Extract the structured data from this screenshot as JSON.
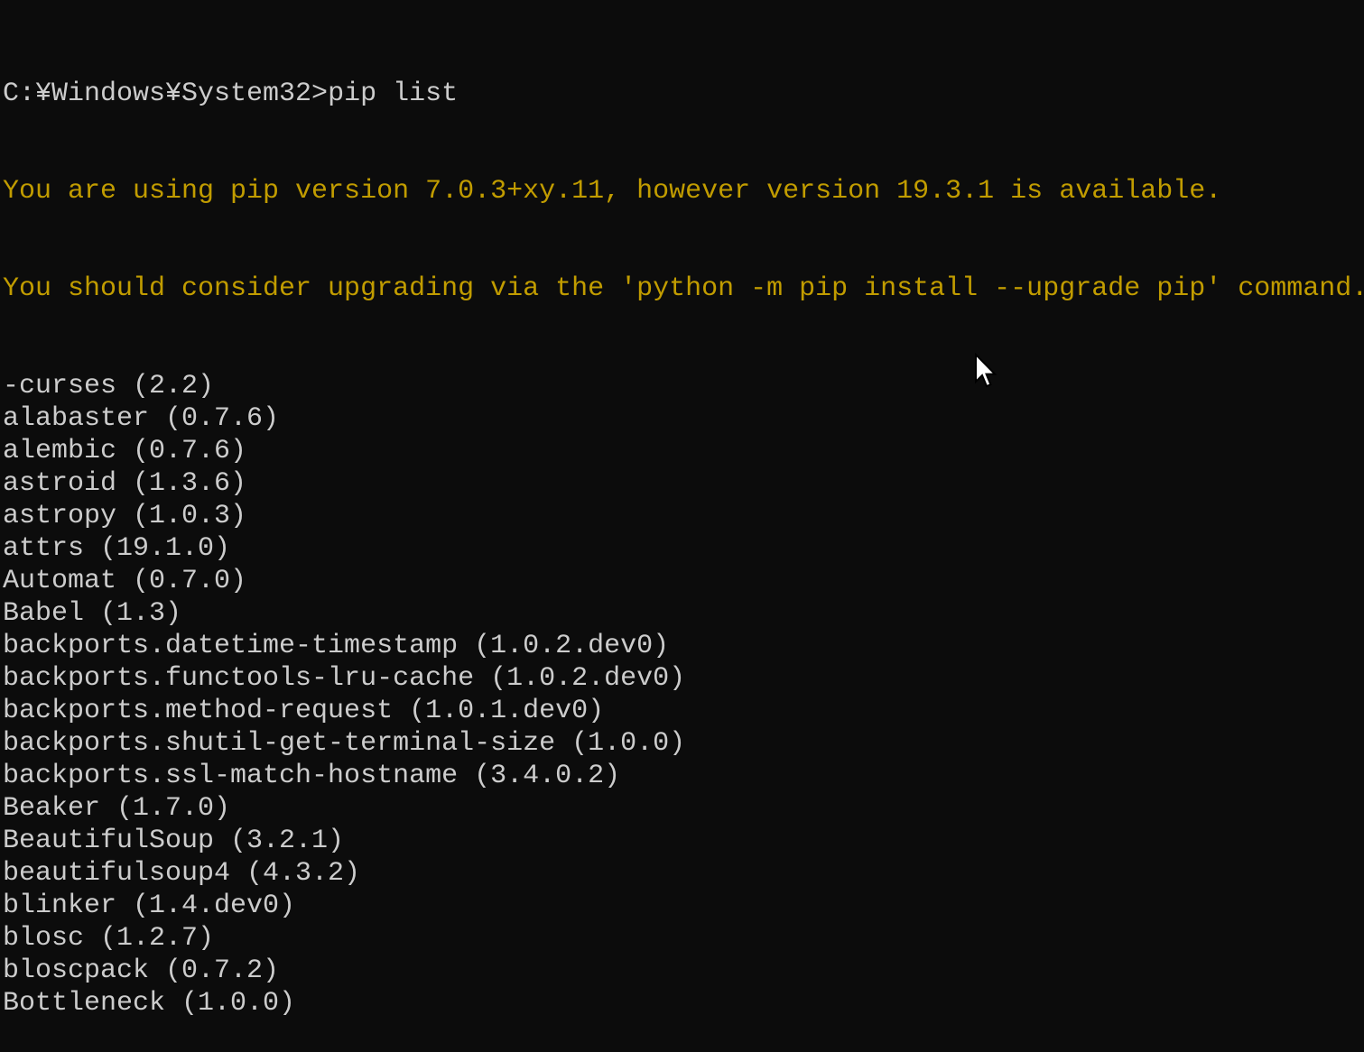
{
  "terminal": {
    "prompt": "C:¥Windows¥System32>",
    "command": "pip list",
    "warnings": [
      "You are using pip version 7.0.3+xy.11, however version 19.3.1 is available.",
      "You should consider upgrading via the 'python -m pip install --upgrade pip' command."
    ],
    "packages": [
      "-curses (2.2)",
      "alabaster (0.7.6)",
      "alembic (0.7.6)",
      "astroid (1.3.6)",
      "astropy (1.0.3)",
      "attrs (19.1.0)",
      "Automat (0.7.0)",
      "Babel (1.3)",
      "backports.datetime-timestamp (1.0.2.dev0)",
      "backports.functools-lru-cache (1.0.2.dev0)",
      "backports.method-request (1.0.1.dev0)",
      "backports.shutil-get-terminal-size (1.0.0)",
      "backports.ssl-match-hostname (3.4.0.2)",
      "Beaker (1.7.0)",
      "BeautifulSoup (3.2.1)",
      "beautifulsoup4 (4.3.2)",
      "blinker (1.4.dev0)",
      "blosc (1.2.7)",
      "bloscpack (0.7.2)",
      "Bottleneck (1.0.0)"
    ],
    "colors": {
      "background": "#0c0c0c",
      "text": "#cccccc",
      "warning": "#c19c00"
    }
  },
  "icons": {
    "mouse_cursor": "arrow-pointer"
  }
}
